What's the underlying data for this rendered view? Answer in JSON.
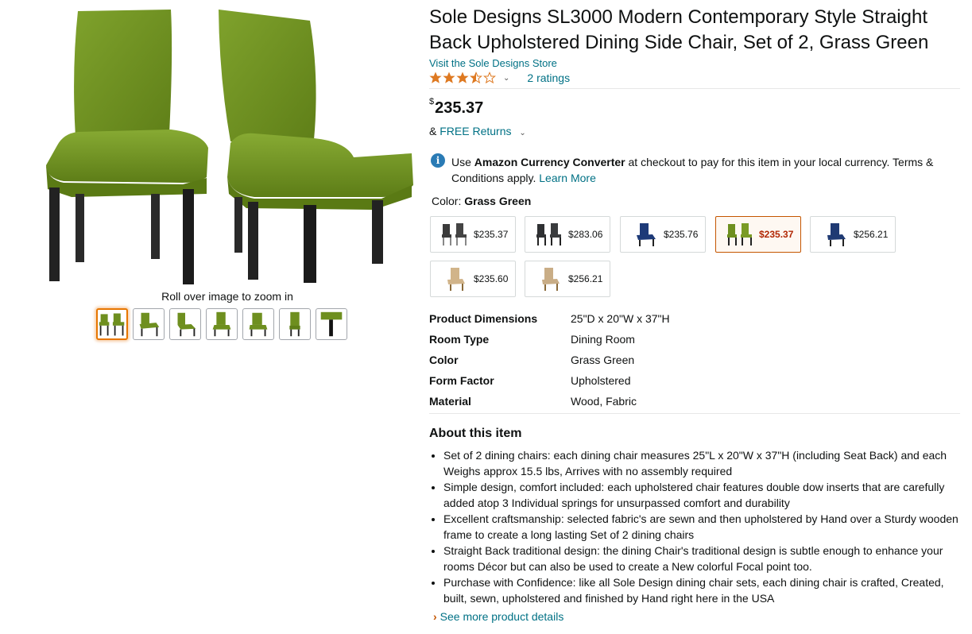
{
  "product": {
    "title": "Sole Designs SL3000 Modern Contemporary Style Straight Back Upholstered Dining Side Chair, Set of 2, Grass Green",
    "store_link": "Visit the Sole Designs Store",
    "rating": {
      "stars": 3.5,
      "count_text": "2 ratings"
    },
    "price": {
      "currency": "$",
      "amount": "235.37"
    },
    "returns": {
      "prefix": "&",
      "label": "FREE Returns"
    }
  },
  "images": {
    "zoom_hint": "Roll over image to zoom in",
    "thumbnails": 7,
    "selected_thumbnail": 0
  },
  "currency_notice": {
    "use": "Use",
    "converter": "Amazon Currency Converter",
    "text": "at checkout to pay for this item in your local currency. Terms & Conditions apply.",
    "learn_more": "Learn More"
  },
  "color": {
    "label": "Color:",
    "selected": "Grass Green",
    "swatches": [
      {
        "price": "$235.37",
        "tone": "#3a3a3a"
      },
      {
        "price": "$283.06",
        "tone": "#2f3133"
      },
      {
        "price": "$235.76",
        "tone": "#1d3a78"
      },
      {
        "price": "$235.37",
        "tone": "#6e8f1f",
        "selected": true
      },
      {
        "price": "$256.21",
        "tone": "#1f3a73"
      },
      {
        "price": "$235.60",
        "tone": "#d1b48a"
      },
      {
        "price": "$256.21",
        "tone": "#c9ad86"
      }
    ]
  },
  "specs": [
    {
      "key": "Product Dimensions",
      "value": "25\"D x 20\"W x 37\"H"
    },
    {
      "key": "Room Type",
      "value": "Dining Room"
    },
    {
      "key": "Color",
      "value": "Grass Green"
    },
    {
      "key": "Form Factor",
      "value": "Upholstered"
    },
    {
      "key": "Material",
      "value": "Wood, Fabric"
    }
  ],
  "about": {
    "title": "About this item",
    "bullets": [
      "Set of 2 dining chairs: each dining chair measures 25\"L x 20\"W x 37\"H (including Seat Back) and each Weighs approx 15.5 lbs, Arrives with no assembly required",
      "Simple design, comfort included: each upholstered chair features double dow inserts that are carefully added atop 3 Individual springs for unsurpassed comfort and durability",
      "Excellent craftsmanship: selected fabric's are sewn and then upholstered by Hand over a Sturdy wooden frame to create a long lasting Set of 2 dining chairs",
      "Straight Back traditional design: the dining Chair's traditional design is subtle enough to enhance your rooms Décor but can also be used to create a New colorful Focal point too.",
      "Purchase with Confidence: like all Sole Design dining chair sets, each dining chair is crafted, Created, built, sewn, upholstered and finished by Hand right here in the USA"
    ],
    "see_more": "See more product details"
  },
  "colors": {
    "link": "#007185",
    "price_red": "#b12704",
    "star": "#de7921",
    "selected_border": "#e77600"
  }
}
